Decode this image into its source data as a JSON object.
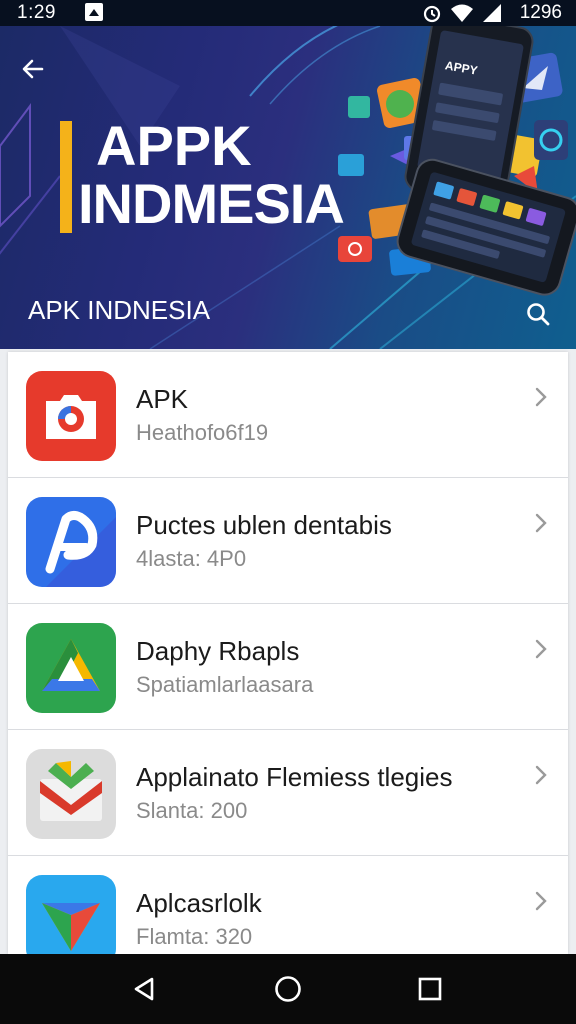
{
  "status_bar": {
    "time": "1:29",
    "right_text": "1296",
    "icons": [
      "notification-icon",
      "alarm-icon",
      "wifi-icon",
      "signal-icon"
    ]
  },
  "header": {
    "brand_line1": "APPK",
    "brand_line2": "INDMESIA",
    "title": "APK INDNESIA",
    "phone_screen_text": "APPY",
    "accent_color": "#f4b21a",
    "icons": [
      "back-arrow-icon",
      "search-icon"
    ]
  },
  "apps": [
    {
      "name": "APK",
      "subtitle": "Heathofo6f19",
      "icon": "camera-app-icon",
      "icon_color": "#e63a2c"
    },
    {
      "name": "Puctes ublen dentabis",
      "subtitle": "4lasta: 4P0",
      "icon": "letter-p-app-icon",
      "icon_color": "#2f6fe8"
    },
    {
      "name": "Daphy Rbapls",
      "subtitle": "Spatiamlarlaasara",
      "icon": "triangle-app-icon",
      "icon_color": "#2da44e"
    },
    {
      "name": "Applainato Flemiess tlegies",
      "subtitle": "Slanta: 200",
      "icon": "gmail-like-app-icon",
      "icon_color": "#d8d8d8"
    },
    {
      "name": "Aplcasrlolk",
      "subtitle": "Flamta: 320",
      "icon": "play-store-app-icon",
      "icon_color": "#29a8ee"
    }
  ],
  "nav_bar": {
    "buttons": [
      "back-nav-icon",
      "home-nav-icon",
      "recents-nav-icon"
    ]
  }
}
